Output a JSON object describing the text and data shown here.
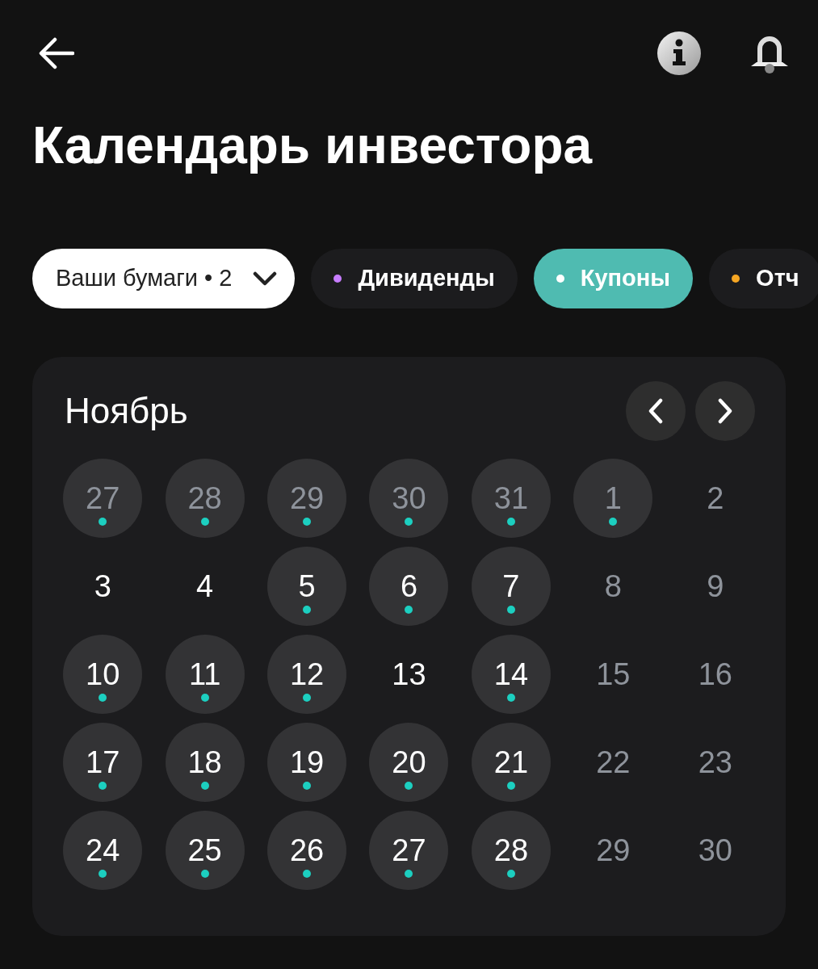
{
  "header": {
    "title": "Календарь инвестора"
  },
  "filters": [
    {
      "kind": "dropdown",
      "label": "Ваши бумаги • 2",
      "selected": false
    },
    {
      "kind": "chip",
      "label": "Дивиденды",
      "selected": false,
      "color": "#c77dff"
    },
    {
      "kind": "chip",
      "label": "Купоны",
      "selected": true,
      "color": "#ffffff"
    },
    {
      "kind": "chip",
      "label": "Отч",
      "selected": false,
      "color": "#f5a623"
    }
  ],
  "calendar": {
    "month": "Ноябрь",
    "days": [
      {
        "label": "27",
        "muted": true,
        "event": true
      },
      {
        "label": "28",
        "muted": true,
        "event": true
      },
      {
        "label": "29",
        "muted": true,
        "event": true
      },
      {
        "label": "30",
        "muted": true,
        "event": true
      },
      {
        "label": "31",
        "muted": true,
        "event": true
      },
      {
        "label": "1",
        "muted": true,
        "event": true
      },
      {
        "label": "2",
        "muted": true,
        "event": false
      },
      {
        "label": "3",
        "muted": false,
        "event": false
      },
      {
        "label": "4",
        "muted": false,
        "event": false
      },
      {
        "label": "5",
        "muted": false,
        "event": true
      },
      {
        "label": "6",
        "muted": false,
        "event": true
      },
      {
        "label": "7",
        "muted": false,
        "event": true
      },
      {
        "label": "8",
        "muted": true,
        "event": false
      },
      {
        "label": "9",
        "muted": true,
        "event": false
      },
      {
        "label": "10",
        "muted": false,
        "event": true
      },
      {
        "label": "11",
        "muted": false,
        "event": true
      },
      {
        "label": "12",
        "muted": false,
        "event": true
      },
      {
        "label": "13",
        "muted": false,
        "event": false
      },
      {
        "label": "14",
        "muted": false,
        "event": true
      },
      {
        "label": "15",
        "muted": true,
        "event": false
      },
      {
        "label": "16",
        "muted": true,
        "event": false
      },
      {
        "label": "17",
        "muted": false,
        "event": true
      },
      {
        "label": "18",
        "muted": false,
        "event": true
      },
      {
        "label": "19",
        "muted": false,
        "event": true
      },
      {
        "label": "20",
        "muted": false,
        "event": true
      },
      {
        "label": "21",
        "muted": false,
        "event": true
      },
      {
        "label": "22",
        "muted": true,
        "event": false
      },
      {
        "label": "23",
        "muted": true,
        "event": false
      },
      {
        "label": "24",
        "muted": false,
        "event": true
      },
      {
        "label": "25",
        "muted": false,
        "event": true
      },
      {
        "label": "26",
        "muted": false,
        "event": true
      },
      {
        "label": "27",
        "muted": false,
        "event": true
      },
      {
        "label": "28",
        "muted": false,
        "event": true
      },
      {
        "label": "29",
        "muted": true,
        "event": false
      },
      {
        "label": "30",
        "muted": true,
        "event": false
      }
    ]
  }
}
